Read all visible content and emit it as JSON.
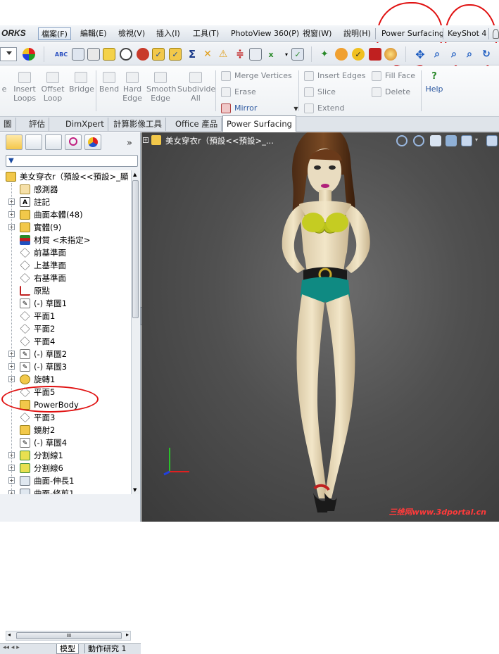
{
  "menubar": {
    "brand": "ORKS",
    "items": [
      {
        "label": "檔案(F)"
      },
      {
        "label": "編輯(E)"
      },
      {
        "label": "檢視(V)"
      },
      {
        "label": "插入(I)"
      },
      {
        "label": "工具(T)"
      },
      {
        "label": "PhotoView 360(P)"
      },
      {
        "label": "視窗(W)"
      },
      {
        "label": "說明(H)"
      },
      {
        "label": "Power Surfacing"
      },
      {
        "label": "KeyShot 4"
      }
    ]
  },
  "command_manager": {
    "left_buttons": [
      {
        "label": "e"
      },
      {
        "label": "Insert\nLoops"
      },
      {
        "label": "Offset\nLoop"
      },
      {
        "label": "Bridge"
      },
      {
        "label": "Bend"
      },
      {
        "label": "Hard\nEdge"
      },
      {
        "label": "Smooth\nEdge"
      },
      {
        "label": "Subdivide\nAll"
      }
    ],
    "col1": [
      "Merge Vertices",
      "Erase",
      "Mirror"
    ],
    "col2": [
      "Insert Edges",
      "Slice",
      "Extend"
    ],
    "col3": [
      "Fill Face",
      "Delete"
    ],
    "help": "Help"
  },
  "tabs": [
    "圖",
    "評估",
    "DimXpert",
    "計算影像工具",
    "Office 產品",
    "Power Surfacing"
  ],
  "feature_tree": {
    "root": "美女穿衣r（預設<<預設>_顯",
    "items": [
      {
        "label": "感測器",
        "expand": false,
        "icon": "sensor-icon"
      },
      {
        "label": "註記",
        "expand": true,
        "icon": "annotation-icon"
      },
      {
        "label": "曲面本體(48)",
        "expand": true,
        "icon": "surface-bodies-icon"
      },
      {
        "label": "實體(9)",
        "expand": true,
        "icon": "solid-bodies-icon"
      },
      {
        "label": "材質 <未指定>",
        "expand": false,
        "icon": "material-icon"
      },
      {
        "label": "前基準面",
        "expand": false,
        "icon": "plane-icon"
      },
      {
        "label": "上基準面",
        "expand": false,
        "icon": "plane-icon"
      },
      {
        "label": "右基準面",
        "expand": false,
        "icon": "plane-icon"
      },
      {
        "label": "原點",
        "expand": false,
        "icon": "origin-icon"
      },
      {
        "label": "(-) 草圖1",
        "expand": false,
        "icon": "sketch-icon"
      },
      {
        "label": "平面1",
        "expand": false,
        "icon": "plane-icon"
      },
      {
        "label": "平面2",
        "expand": false,
        "icon": "plane-icon"
      },
      {
        "label": "平面4",
        "expand": false,
        "icon": "plane-icon"
      },
      {
        "label": "(-) 草圖2",
        "expand": true,
        "icon": "sketch-icon"
      },
      {
        "label": "(-) 草圖3",
        "expand": true,
        "icon": "sketch-icon"
      },
      {
        "label": "旋轉1",
        "expand": true,
        "icon": "revolve-icon"
      },
      {
        "label": "平面5",
        "expand": false,
        "icon": "plane-icon"
      },
      {
        "label": "PowerBody",
        "expand": false,
        "icon": "powerbody-icon"
      },
      {
        "label": "平面3",
        "expand": false,
        "icon": "plane-icon"
      },
      {
        "label": "鏡射2",
        "expand": false,
        "icon": "mirror-icon"
      },
      {
        "label": "(-) 草圖4",
        "expand": false,
        "icon": "sketch-icon"
      },
      {
        "label": "分割線1",
        "expand": true,
        "icon": "split-line-icon"
      },
      {
        "label": "分割線6",
        "expand": true,
        "icon": "split-line-icon"
      },
      {
        "label": "曲面-伸長1",
        "expand": true,
        "icon": "surface-extrude-icon"
      },
      {
        "label": "曲面-修剪1",
        "expand": true,
        "icon": "surface-trim-icon"
      }
    ],
    "hscroll_label": "III",
    "bottom_tabs": [
      "模型",
      "動作研究 1"
    ]
  },
  "viewport": {
    "title": "美女穿衣r（預設<<預設>_...",
    "watermark": "三维网www.3dportal.cn"
  },
  "colors": {
    "annotation": "#e01010",
    "viewport_bg": "#505050",
    "bra": "#b9c21a",
    "shorts": "#0f8a82"
  }
}
